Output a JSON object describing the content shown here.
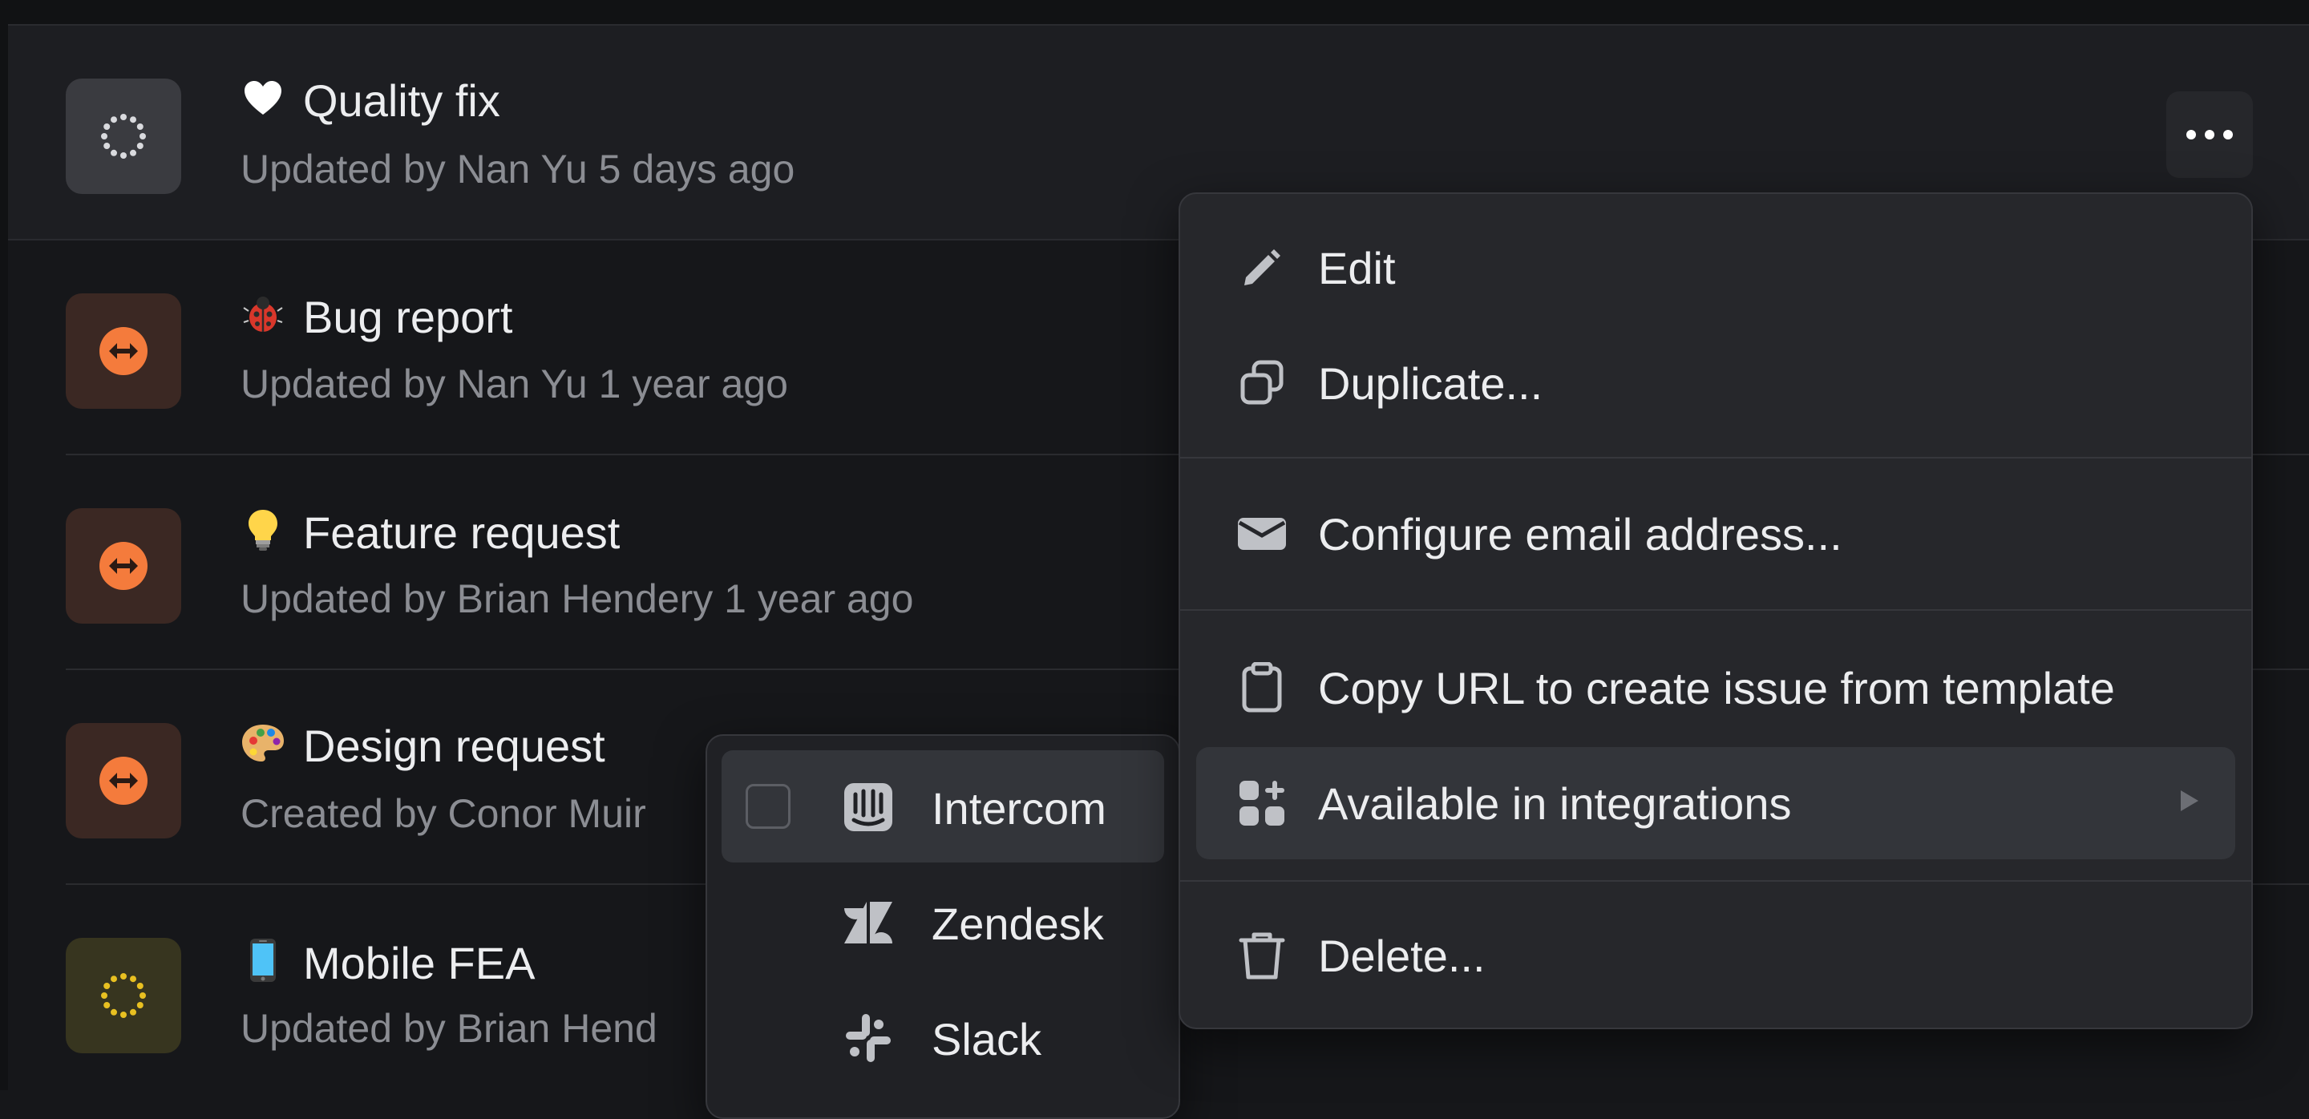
{
  "templates": [
    {
      "emoji": "❤️",
      "title": "Quality fix",
      "subtitle": "Updated by Nan Yu 5 days ago",
      "icon": "dashed-circle-icon",
      "icon_bg": "#3a3b40",
      "icon_color": "#d9dade"
    },
    {
      "emoji": "🐞",
      "title": "Bug report",
      "subtitle": "Updated by Nan Yu 1 year ago",
      "icon": "intercom-arrows-icon",
      "icon_bg": "#3b2823",
      "icon_color": "#f47b3c"
    },
    {
      "emoji": "💡",
      "title": "Feature request",
      "subtitle": "Updated by Brian Hendery 1 year ago",
      "icon": "intercom-arrows-icon",
      "icon_bg": "#3b2823",
      "icon_color": "#f47b3c"
    },
    {
      "emoji": "🎨",
      "title": "Design request",
      "subtitle": "Created by Conor Muir",
      "icon": "intercom-arrows-icon",
      "icon_bg": "#3b2823",
      "icon_color": "#f47b3c"
    },
    {
      "emoji": "📱",
      "title": "Mobile FEA",
      "subtitle": "Updated by Brian Hend",
      "icon": "dashed-circle-icon",
      "icon_bg": "#37351f",
      "icon_color": "#e8c021"
    }
  ],
  "more_button": {
    "icon": "more-horizontal-icon"
  },
  "context_menu": {
    "items": [
      {
        "label": "Edit",
        "icon": "pencil-icon"
      },
      {
        "label": "Duplicate...",
        "icon": "duplicate-icon"
      },
      {
        "label": "Configure email address...",
        "icon": "envelope-icon"
      },
      {
        "label": "Copy URL to create issue from template",
        "icon": "clipboard-icon"
      },
      {
        "label": "Available in integrations",
        "icon": "integrations-grid-icon"
      },
      {
        "label": "Delete...",
        "icon": "trash-icon"
      }
    ]
  },
  "integrations_submenu": {
    "items": [
      {
        "label": "Intercom",
        "icon": "intercom-icon"
      },
      {
        "label": "Zendesk",
        "icon": "zendesk-icon"
      },
      {
        "label": "Slack",
        "icon": "slack-icon"
      }
    ]
  }
}
